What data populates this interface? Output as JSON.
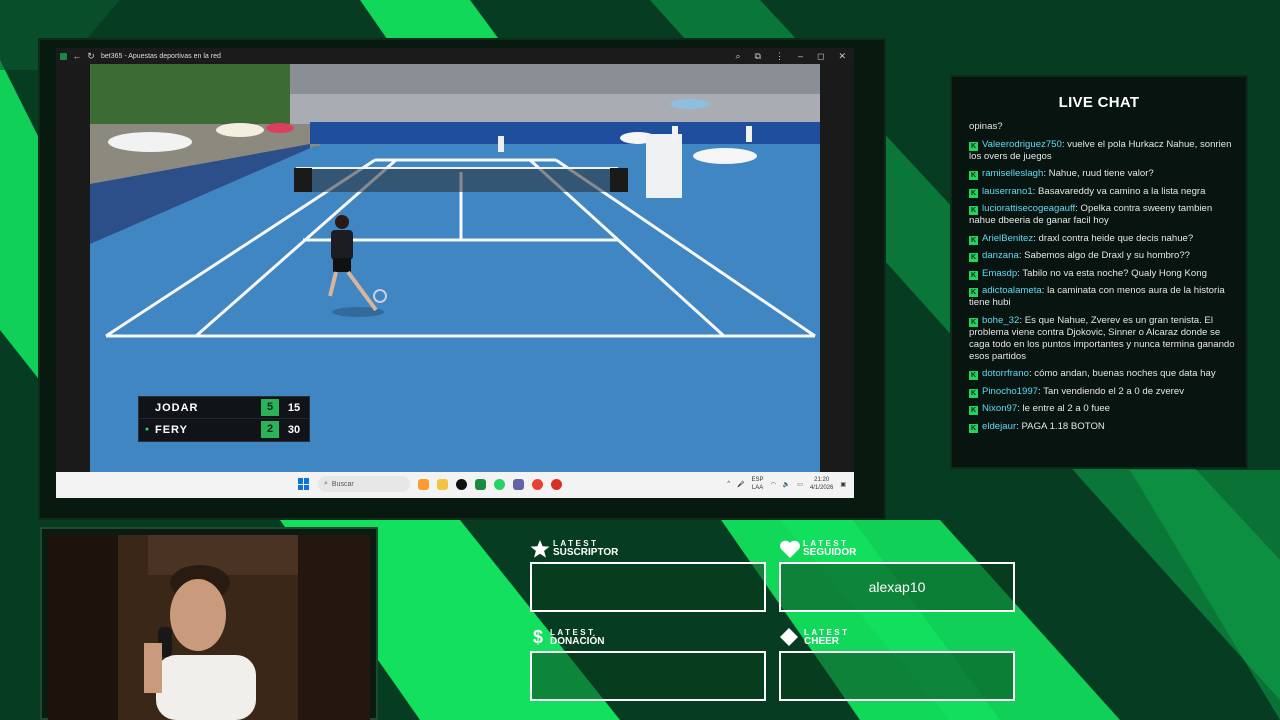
{
  "browser": {
    "tab_title": "bet365 - Apuestas deportivas en la red"
  },
  "scoreboard": {
    "players": [
      {
        "name": "JODAR",
        "games": "5",
        "points": "15",
        "serving": false
      },
      {
        "name": "FERY",
        "games": "2",
        "points": "30",
        "serving": true
      }
    ],
    "serve_marker": "●"
  },
  "taskbar": {
    "search_placeholder": "Buscar",
    "lang": "ESP",
    "lang2": "LAA",
    "time": "21:20",
    "date": "4/1/2026"
  },
  "chat": {
    "title": "LIVE CHAT",
    "top_fragment": "opinas?",
    "messages": [
      {
        "user": "Valeerodriguez750",
        "text": "vuelve el pola Hurkacz Nahue, sonrien los overs de juegos"
      },
      {
        "user": "ramiselleslagh",
        "text": "Nahue, ruud tiene valor?"
      },
      {
        "user": "lauserrano1",
        "text": "Basavareddy va camino a la lista negra"
      },
      {
        "user": "luciorattisecogeagauff",
        "text": "Opelka contra sweeny tambien nahue dbeeria de ganar facil hoy"
      },
      {
        "user": "ArielBenitez",
        "text": "draxl contra heide que decis nahue?"
      },
      {
        "user": "danzana",
        "text": "Sabemos algo de Draxl y su hombro??"
      },
      {
        "user": "Emasdp",
        "text": "Tabilo no va esta noche? Qualy Hong Kong"
      },
      {
        "user": "adictoalameta",
        "text": "la caminata con menos aura de la historia tiene hubi"
      },
      {
        "user": "bohe_32",
        "text": "Es que Nahue, Zverev es un gran tenista. El problema viene contra Djokovic, Sinner o Alcaraz donde se caga todo en los puntos importantes y nunca termina ganando esos partidos"
      },
      {
        "user": "dotorrfrano",
        "text": "cómo andan, buenas noches que data hay"
      },
      {
        "user": "Pinocho1997",
        "text": "Tan vendiendo el 2 a 0 de zverev"
      },
      {
        "user": "Nixon97",
        "text": "le entre al 2 a 0 fuee"
      },
      {
        "user": "eldejaur",
        "text": "PAGA 1.18 BOTON"
      }
    ],
    "badge": "K"
  },
  "widgets": {
    "latest_word": "LATEST",
    "suscriptor": {
      "label": "SUSCRIPTOR",
      "value": ""
    },
    "seguidor": {
      "label": "SEGUIDOR",
      "value": "alexap10"
    },
    "donacion": {
      "label": "DONACIÓN",
      "value": ""
    },
    "cheer": {
      "label": "CHEER",
      "value": ""
    }
  },
  "colors": {
    "accent": "#13e05e",
    "background": "#063d22",
    "chat_user": "#62d9f5",
    "court": "#3f86c3"
  }
}
